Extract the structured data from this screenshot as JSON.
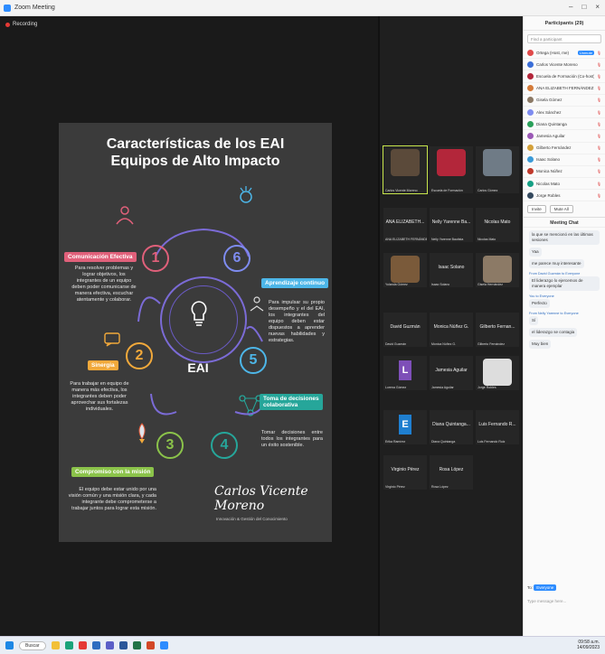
{
  "window": {
    "title": "Zoom Meeting",
    "recording": "Recording",
    "controls": [
      "–",
      "□",
      "×"
    ]
  },
  "slide": {
    "title_line1": "Características de los EAI",
    "title_line2": "Equipos de Alto Impacto",
    "center_label": "EAI",
    "items": [
      {
        "num": "1",
        "label": "Comunicación Efectiva",
        "color": "#e0607a",
        "desc": "Para resolver problemas y lograr objetivos, los integrantes de un equipo deben poder comunicarse de manera efectiva, escuchar atentamente y colaborar."
      },
      {
        "num": "2",
        "label": "Sinergia",
        "color": "#f2a93b",
        "desc": "Para trabajar en equipo de manera más efectiva, los integrantes deben poder aprovechar sus fortalezas individuales."
      },
      {
        "num": "3",
        "label": "Compromiso con la misión",
        "color": "#8bc34a",
        "desc": "El equipo debe estar unido por una visión común y una misión clara, y cada integrante debe comprometerse a trabajar juntos para lograr esta misión."
      },
      {
        "num": "4",
        "label": "Toma de decisiones colaborativa",
        "color": "#26a69a",
        "desc": "Tomar decisiones entre todos los integrantes para un éxito sostenible."
      },
      {
        "num": "5",
        "label": "Aprendizaje continuo",
        "color": "#4db6e8",
        "desc": "Para impulsar su propio desempeño y el del EAI, los integrantes del equipo deben estar dispuestos a aprender nuevas habilidades y estrategias."
      },
      {
        "num": "6",
        "label": "",
        "color": "#7e8cf0",
        "desc": ""
      }
    ],
    "signature": "Carlos Vicente Moreno",
    "signature_sub": "Innovación & Gestión del Conocimiento"
  },
  "gallery": [
    {
      "name": "",
      "tag": "Carlos Vicente Moreno",
      "kind": "photo",
      "bg": "#5b4a3a"
    },
    {
      "name": "",
      "tag": "Escuela de Formación",
      "kind": "photo",
      "bg": "#b3263a"
    },
    {
      "name": "",
      "tag": "Carlos Gómez",
      "kind": "photo",
      "bg": "#6f7b86"
    },
    {
      "name": "ANA ELIZABETH...",
      "tag": "ANA ELIZABETH FERNÁNDEZ",
      "kind": "name"
    },
    {
      "name": "Nelly Yarenne Ba...",
      "tag": "Nelly Yarenne Bautista",
      "kind": "name"
    },
    {
      "name": "Nicolas Mato",
      "tag": "Nicolas Mato",
      "kind": "name"
    },
    {
      "name": "",
      "tag": "Yolanda Gómez",
      "kind": "photo",
      "bg": "#7a5a3a"
    },
    {
      "name": "Isaac Solano",
      "tag": "Isaac Solano",
      "kind": "name"
    },
    {
      "name": "",
      "tag": "Gisela Hernández",
      "kind": "photo",
      "bg": "#8c7a66"
    },
    {
      "name": "David Guzmán",
      "tag": "David Guzmán",
      "kind": "name"
    },
    {
      "name": "Monica Núñez G.",
      "tag": "Monica Núñez G.",
      "kind": "name"
    },
    {
      "name": "Gilberto Fernan...",
      "tag": "Gilberto Fernández",
      "kind": "name"
    },
    {
      "name": "",
      "tag": "Lorena Gómez",
      "kind": "L"
    },
    {
      "name": "Jamesia Aguilar",
      "tag": "Jamesia Aguilar",
      "kind": "name"
    },
    {
      "name": "",
      "tag": "Jorge Robles",
      "kind": "photo",
      "bg": "#dddddd"
    },
    {
      "name": "",
      "tag": "Erika Ramírez",
      "kind": "E"
    },
    {
      "name": "Diana Quintanga...",
      "tag": "Diana Quintanga",
      "kind": "name"
    },
    {
      "name": "Luis Fernando R...",
      "tag": "Luis Fernando Ruiz",
      "kind": "name"
    },
    {
      "name": "Virginio Pérez",
      "tag": "Virginio Pérez",
      "kind": "name"
    },
    {
      "name": "Rosa López",
      "tag": "Rosa López",
      "kind": "name"
    }
  ],
  "participants": {
    "title": "Participants (29)",
    "search_placeholder": "Find a participant",
    "rows": [
      {
        "name": "Ortega (Host, me)",
        "color": "#e04a4a",
        "badge": "Unmute"
      },
      {
        "name": "Carlos Vicente Moreno",
        "color": "#3b6ed8"
      },
      {
        "name": "Escuela de Formación (Co-host)",
        "color": "#b3263a"
      },
      {
        "name": "ANA ELIZABETH FERNÁNDEZ",
        "color": "#d47b3a"
      },
      {
        "name": "Gisela Gómez",
        "color": "#8c7a66"
      },
      {
        "name": "Alex Sánchez",
        "color": "#7e8cf0"
      },
      {
        "name": "Diana Quintanga",
        "color": "#2aa05a"
      },
      {
        "name": "Jamesia Aguilar",
        "color": "#9b59b6"
      },
      {
        "name": "Gilberto Fernández",
        "color": "#d4a13a"
      },
      {
        "name": "Isaac Solano",
        "color": "#3b9bd8"
      },
      {
        "name": "Monica Núñez",
        "color": "#c0392b"
      },
      {
        "name": "Nicolas Mato",
        "color": "#16a085"
      },
      {
        "name": "Jorge Robles",
        "color": "#34495e"
      }
    ],
    "invite_label": "Invite",
    "mute_all_label": "Mute All"
  },
  "chat": {
    "title": "Meeting Chat",
    "messages": [
      {
        "meta": "",
        "text": "la que se mencionó en las últimas sesiones"
      },
      {
        "meta": "",
        "text": "Yaa"
      },
      {
        "meta": "",
        "text": "me parece muy interesante"
      },
      {
        "meta": "From David Guzmán to Everyone",
        "text": "El liderazgo lo ejercemos de manera ejemplar"
      },
      {
        "meta": "You to Everyone",
        "text": "Perfecto"
      },
      {
        "meta": "From Nelly Yarenne to Everyone",
        "text": "Sí"
      },
      {
        "meta": "",
        "text": "el liderazgo se contagia"
      },
      {
        "meta": "",
        "text": "Muy bien"
      }
    ],
    "to_label": "To:",
    "to_value": "Everyone",
    "placeholder": "Type message here..."
  },
  "taskbar": {
    "search": "Buscar",
    "time": "09:58 a.m.",
    "date": "14/09/2023"
  }
}
